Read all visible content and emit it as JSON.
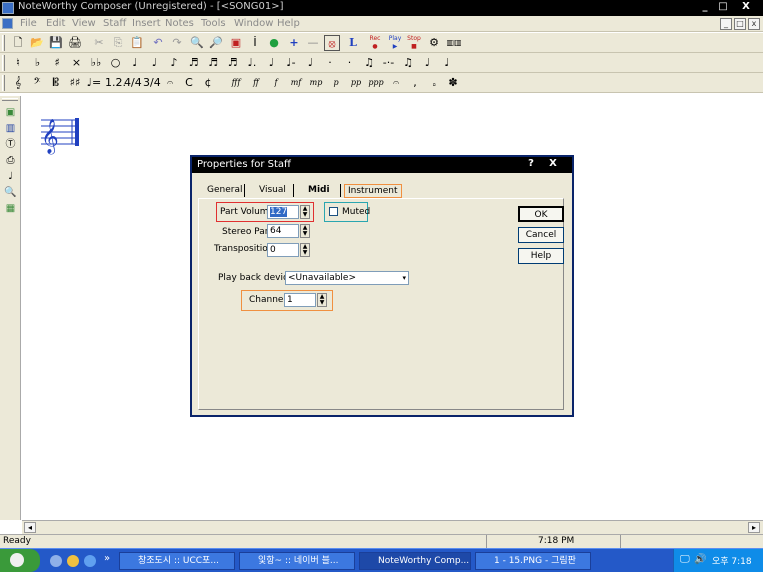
{
  "window": {
    "title": "NoteWorthy Composer (Unregistered) - [<SONG01>]",
    "minimize": "_",
    "restore": "□",
    "close": "X"
  },
  "menubar": {
    "items": [
      "File",
      "Edit",
      "View",
      "Staff",
      "Insert",
      "Notes",
      "Tools",
      "Window",
      "Help"
    ],
    "mdi_min": "_",
    "mdi_restore": "□",
    "mdi_close": "x"
  },
  "toolbar1": {
    "tools": [
      "🗋",
      "📂",
      "💾",
      "🖨",
      "✂",
      "⎘",
      "📋",
      "↶",
      "↷",
      "🔍",
      "🔎",
      "▣",
      "İ",
      "●",
      "+",
      "—",
      "⦻",
      "L"
    ],
    "record": "Rec",
    "play": "Play",
    "stop": "Stop"
  },
  "toolbar2": {
    "symbols": [
      "♮",
      "♭",
      "♯",
      "×",
      "♭♭",
      "○",
      "♩",
      "♩",
      "♪",
      "♬",
      "♬",
      "♬",
      "♩.",
      "♩",
      "♩-",
      "♩",
      "·",
      "·",
      "♫",
      "-·-",
      "♫",
      "♩",
      "♩"
    ]
  },
  "toolbar3": {
    "symbols": [
      "𝄞",
      "𝄢",
      "𝄡",
      "♯♯",
      "♩=",
      "1.2.",
      "4/4",
      "3/4",
      "𝄐",
      "C",
      "¢"
    ],
    "dynamics": [
      "fff",
      "ff",
      "f",
      "mf",
      "mp",
      "p",
      "pp",
      "ppp"
    ],
    "extras": [
      "𝄐",
      ",",
      "𝅆",
      "✽"
    ]
  },
  "left_tools": [
    "▣",
    "▥",
    "Ⓣ",
    "⎙",
    "♩",
    "🔍",
    "▦"
  ],
  "status": {
    "left": "Ready",
    "time": "7:18 PM"
  },
  "dialog": {
    "title": "Properties for Staff",
    "help_btn": "?",
    "close_btn": "X",
    "tabs": [
      "General",
      "Visual",
      "Midi",
      "Instrument"
    ],
    "active_tab": "Midi",
    "part_volume_label": "Part Volume:",
    "part_volume_value": "127",
    "muted_label": "Muted",
    "muted_checked": false,
    "stereo_pan_label": "Stereo Pan:",
    "stereo_pan_value": "64",
    "transposition_label": "Transposition:",
    "transposition_value": "0",
    "playback_device_label": "Play back device:",
    "playback_device_value": "<Unavailable>",
    "channel_label": "Channel:",
    "channel_value": "1",
    "ok": "OK",
    "cancel": "Cancel",
    "help": "Help"
  },
  "taskbar": {
    "start": "",
    "arrows": "»",
    "tasks": [
      "창조도시 :: UCC포...",
      "잋항~ :: 네이버 블...",
      "NoteWorthy Comp...",
      "1 - 15.PNG - 그림판"
    ],
    "clock": "오후 7:18"
  },
  "accent": {
    "highlight_red": "#e03030",
    "highlight_orange": "#f09040",
    "highlight_teal": "#2aa6b0",
    "selection_blue": "#316ac5"
  }
}
